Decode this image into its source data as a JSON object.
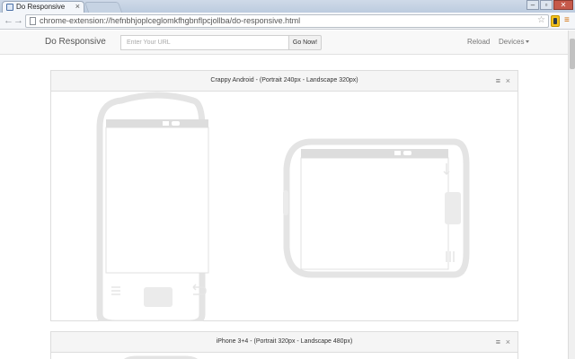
{
  "browser": {
    "tab_title": "Do Responsive",
    "tab_close": "×",
    "url": "chrome-extension://hefnbhjoplceglomkfhgbnflpcjollba/do-responsive.html",
    "window_controls": [
      "–",
      "▫",
      "✕"
    ]
  },
  "navbar": {
    "brand": "Do Responsive",
    "url_placeholder": "Enter Your URL",
    "go_label": "Go Now!",
    "reload_label": "Reload",
    "devices_label": "Devices"
  },
  "panels": [
    {
      "title": "Crappy Android - (Portrait 240px - Landscape 320px)",
      "menu_icon": "≡",
      "close_icon": "×"
    },
    {
      "title": "iPhone 3+4 - (Portrait 320px - Landscape 480px)",
      "menu_icon": "≡",
      "close_icon": "×"
    }
  ],
  "colors": {
    "device_outline": "#e6e6e6",
    "screen_bar": "#dcdcdc",
    "close_button": "#c6594a"
  }
}
